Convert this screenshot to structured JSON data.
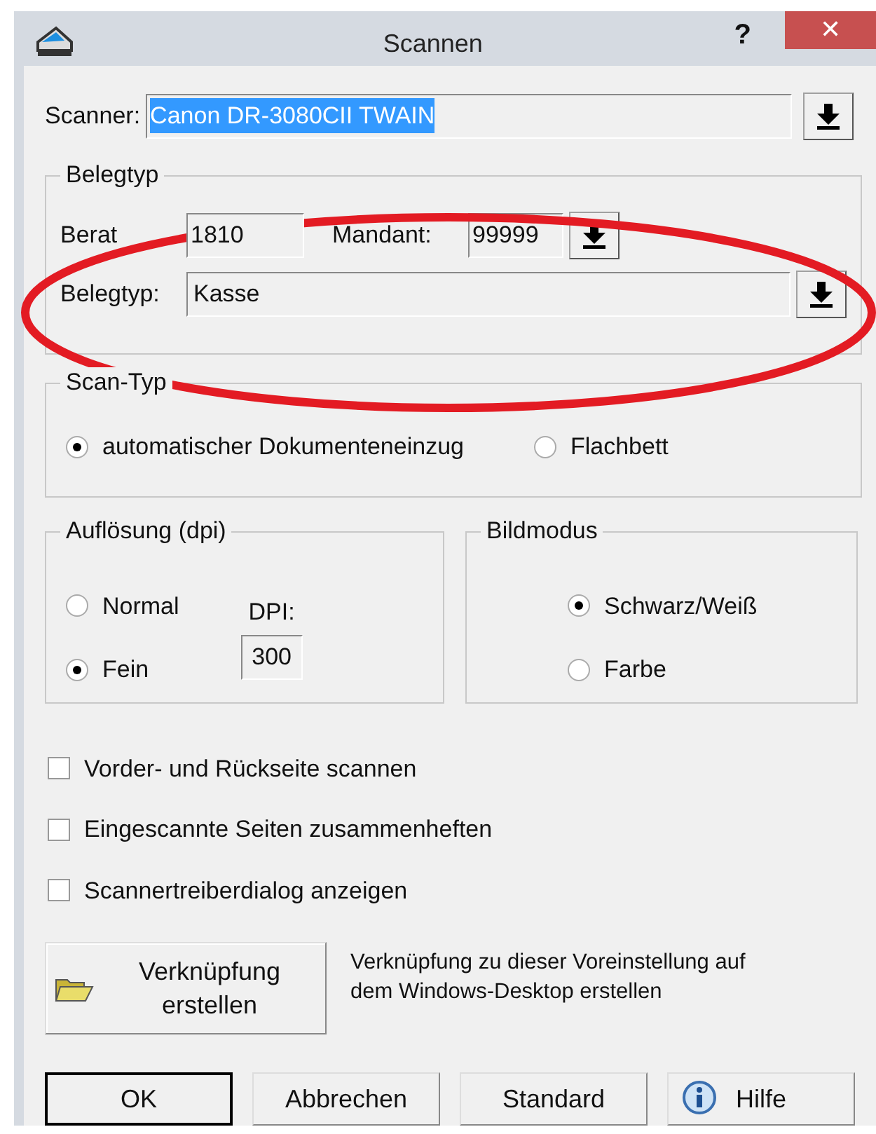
{
  "window": {
    "title": "Scannen",
    "help_glyph": "?",
    "close_glyph": "✕"
  },
  "scanner": {
    "label": "Scanner:",
    "value": "Canon DR-3080CII TWAIN",
    "selected_text": true
  },
  "belegtyp_group": {
    "title": "Belegtyp",
    "berater_label": "Berat",
    "berater_value": "1810",
    "mandant_label": "Mandant:",
    "mandant_value": "99999",
    "belegtyp_label": "Belegtyp:",
    "belegtyp_value": "Kasse"
  },
  "scan_typ": {
    "title": "Scan-Typ",
    "options": [
      {
        "label": "automatischer Dokumenteneinzug",
        "selected": true
      },
      {
        "label": "Flachbett",
        "selected": false
      }
    ]
  },
  "aufloesung": {
    "title": "Auflösung (dpi)",
    "options": [
      {
        "label": "Normal",
        "selected": false
      },
      {
        "label": "Fein",
        "selected": true
      }
    ],
    "dpi_label": "DPI:",
    "dpi_value": "300"
  },
  "bildmodus": {
    "title": "Bildmodus",
    "options": [
      {
        "label": "Schwarz/Weiß",
        "selected": true
      },
      {
        "label": "Farbe",
        "selected": false
      }
    ]
  },
  "checkboxes": [
    {
      "label": "Vorder- und Rückseite scannen",
      "checked": false
    },
    {
      "label": "Eingescannte Seiten zusammenheften",
      "checked": false
    },
    {
      "label": "Scannertreiberdialog anzeigen",
      "checked": false
    }
  ],
  "shortcut": {
    "button_lines": [
      "Verknüpfung",
      "erstellen"
    ],
    "description": "Verknüpfung zu dieser Voreinstellung auf dem Windows-Desktop erstellen"
  },
  "buttons": [
    {
      "kind": "default",
      "label": "OK"
    },
    {
      "kind": "plain",
      "label": "Abbrechen"
    },
    {
      "kind": "plain",
      "label": "Standard"
    },
    {
      "kind": "help",
      "label": "Hilfe"
    }
  ]
}
